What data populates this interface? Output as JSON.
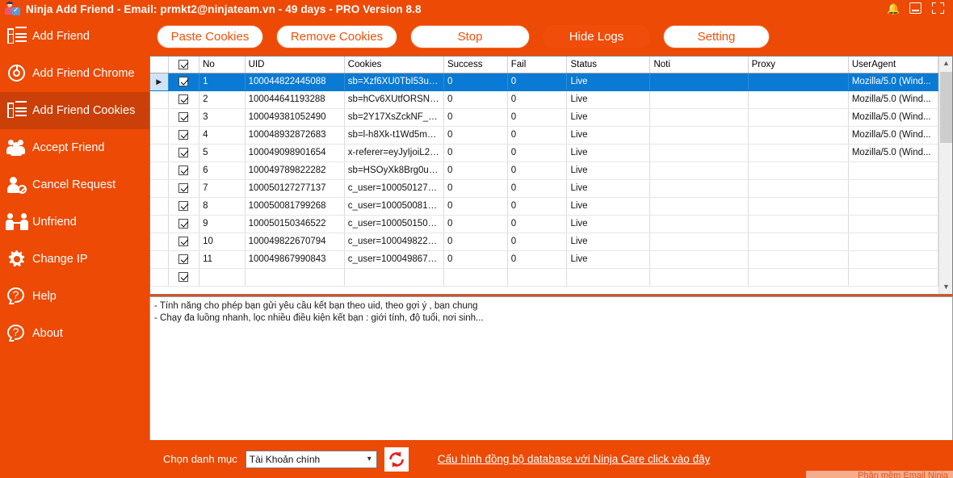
{
  "window": {
    "title": "Ninja Add Friend - Email: prmkt2@ninjateam.vn - 49 days - PRO Version 8.8",
    "app_icon": "person-check-icon",
    "controls": {
      "bell": "bell-icon",
      "minimize": "minimize-icon",
      "fullscreen": "fullscreen-icon"
    }
  },
  "sidebar": {
    "items": [
      {
        "label": "Add Friend",
        "icon": "list-icon",
        "active": false
      },
      {
        "label": "Add Friend Chrome",
        "icon": "chrome-icon",
        "active": false
      },
      {
        "label": "Add Friend Cookies",
        "icon": "list-icon",
        "active": true
      },
      {
        "label": "Accept Friend",
        "icon": "group-icon",
        "active": false
      },
      {
        "label": "Cancel Request",
        "icon": "person-cancel-icon",
        "active": false
      },
      {
        "label": "Unfriend",
        "icon": "unfriend-icon",
        "active": false
      },
      {
        "label": "Change IP",
        "icon": "gear-icon",
        "active": false
      },
      {
        "label": "Help",
        "icon": "question-icon",
        "active": false
      },
      {
        "label": "About",
        "icon": "question-icon",
        "active": false
      }
    ]
  },
  "toolbar": {
    "paste_cookies": "Paste Cookies",
    "remove_cookies": "Remove Cookies",
    "stop": "Stop",
    "hide_logs": "Hide Logs",
    "setting": "Setting"
  },
  "table": {
    "columns": [
      "",
      "",
      "No",
      "UID",
      "Cookies",
      "Success",
      "Fail",
      "Status",
      "Noti",
      "Proxy",
      "UserAgent"
    ],
    "rows": [
      {
        "no": "1",
        "uid": "100044822445088",
        "cookies": "sb=Xzf6XU0TbI53uE...",
        "success": "0",
        "fail": "0",
        "status": "Live",
        "noti": "",
        "proxy": "",
        "useragent": "Mozilla/5.0 (Wind...",
        "checked": true,
        "selected": true
      },
      {
        "no": "2",
        "uid": "100044641193288",
        "cookies": "sb=hCv6XUtfORSNZ...",
        "success": "0",
        "fail": "0",
        "status": "Live",
        "noti": "",
        "proxy": "",
        "useragent": "Mozilla/5.0 (Wind...",
        "checked": true,
        "selected": false
      },
      {
        "no": "3",
        "uid": "100049381052490",
        "cookies": "sb=2Y17XsZckNF_K...",
        "success": "0",
        "fail": "0",
        "status": "Live",
        "noti": "",
        "proxy": "",
        "useragent": "Mozilla/5.0 (Wind...",
        "checked": true,
        "selected": false
      },
      {
        "no": "4",
        "uid": "100048932872683",
        "cookies": "sb=l-h8Xk-t1Wd5mpn...",
        "success": "0",
        "fail": "0",
        "status": "Live",
        "noti": "",
        "proxy": "",
        "useragent": "Mozilla/5.0 (Wind...",
        "checked": true,
        "selected": false
      },
      {
        "no": "5",
        "uid": "100049098901654",
        "cookies": "x-referer=eyJyIjoiL2Vu...",
        "success": "0",
        "fail": "0",
        "status": "Live",
        "noti": "",
        "proxy": "",
        "useragent": "Mozilla/5.0 (Wind...",
        "checked": true,
        "selected": false
      },
      {
        "no": "6",
        "uid": "100049789822282",
        "cookies": "sb=HSOyXk8Brg0uH...",
        "success": "0",
        "fail": "0",
        "status": "Live",
        "noti": "",
        "proxy": "",
        "useragent": "",
        "checked": true,
        "selected": false
      },
      {
        "no": "7",
        "uid": "100050127277137",
        "cookies": "c_user=1000501272...",
        "success": "0",
        "fail": "0",
        "status": "Live",
        "noti": "",
        "proxy": "",
        "useragent": "",
        "checked": true,
        "selected": false
      },
      {
        "no": "8",
        "uid": "100050081799268",
        "cookies": "c_user=1000500817...",
        "success": "0",
        "fail": "0",
        "status": "Live",
        "noti": "",
        "proxy": "",
        "useragent": "",
        "checked": true,
        "selected": false
      },
      {
        "no": "9",
        "uid": "100050150346522",
        "cookies": "c_user=1000501503...",
        "success": "0",
        "fail": "0",
        "status": "Live",
        "noti": "",
        "proxy": "",
        "useragent": "",
        "checked": true,
        "selected": false
      },
      {
        "no": "10",
        "uid": "100049822670794",
        "cookies": "c_user=1000498226...",
        "success": "0",
        "fail": "0",
        "status": "Live",
        "noti": "",
        "proxy": "",
        "useragent": "",
        "checked": true,
        "selected": false
      },
      {
        "no": "11",
        "uid": "100049867990843",
        "cookies": "c_user=1000498679...",
        "success": "0",
        "fail": "0",
        "status": "Live",
        "noti": "",
        "proxy": "",
        "useragent": "",
        "checked": true,
        "selected": false
      }
    ]
  },
  "log": {
    "line1": "- Tính năng cho phép bạn gửi yêu cầu kết bạn theo uid, theo gợi ý , bạn chung",
    "line2": "- Chạy đa luồng nhanh, lọc nhiều điều kiện kết bạn : giới tính, độ tuổi, nơi sinh..."
  },
  "bottom": {
    "category_label": "Chọn danh mục",
    "category_value": "Tài Khoản chính",
    "refresh_icon": "refresh-icon",
    "link": "Cấu hình đồng bộ database với Ninja Care click vào đây",
    "footer_partial": "Phần mềm Email Ninja"
  },
  "colors": {
    "brand_orange": "#ec4a05",
    "sidebar_active": "#cb3f08",
    "button_text": "#f1500a",
    "selection_blue": "#0a7ad4",
    "refresh_red": "#e8201a"
  }
}
